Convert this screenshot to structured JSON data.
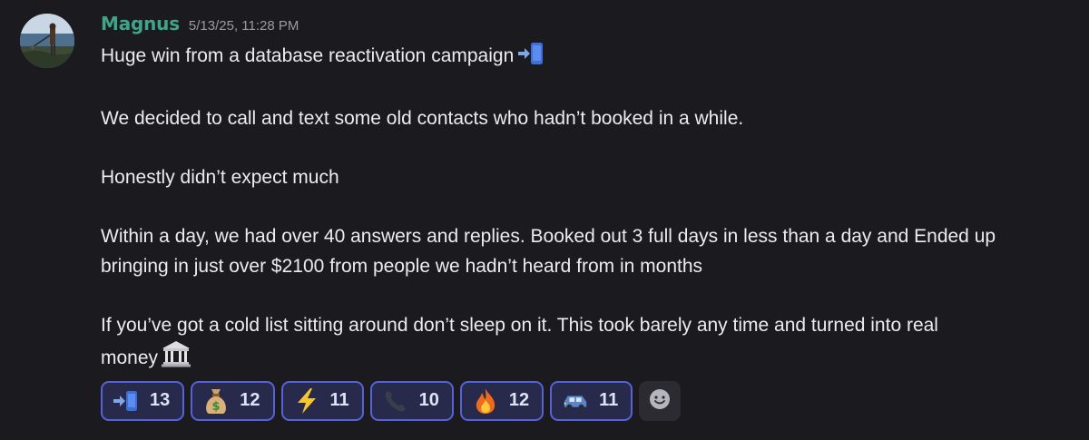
{
  "message": {
    "username": "Magnus",
    "timestamp": "5/13/25, 11:28 PM",
    "lines": [
      "Huge win from a database reactivation campaign",
      "",
      "We decided to call and text some old contacts who hadn’t booked in a while.",
      "",
      "Honestly didn’t expect much",
      "",
      "Within a day, we had over 40 answers and replies. Booked out 3 full days in less than a day and Ended up",
      "bringing in just over $2100 from people we hadn’t heard from in months",
      "",
      "If you’ve got a cold list sitting around don’t sleep on it. This took barely any time and turned into real",
      "money"
    ],
    "inline_emojis": [
      "incoming-phone-emoji",
      "bank-emoji"
    ]
  },
  "reactions": [
    {
      "icon": "incoming-phone-emoji",
      "count": "13"
    },
    {
      "icon": "money-bag-emoji",
      "count": "12"
    },
    {
      "icon": "lightning-emoji",
      "count": "11"
    },
    {
      "icon": "telephone-receiver-emoji",
      "count": "10"
    },
    {
      "icon": "fire-emoji",
      "count": "12"
    },
    {
      "icon": "car-emoji",
      "count": "11"
    }
  ],
  "add_reaction": {
    "icon": "smiley-icon"
  },
  "colors": {
    "background": "#1b1b1f",
    "username": "#3fa58a",
    "timestamp": "#9a9aa2",
    "reaction_border": "#5662d8",
    "reaction_bg": "#272a4a"
  }
}
